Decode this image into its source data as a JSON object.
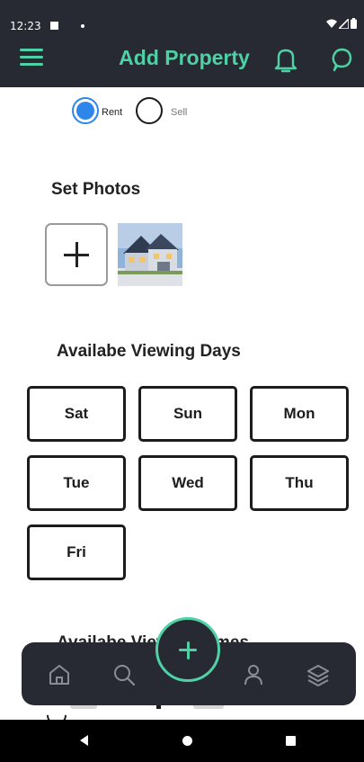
{
  "status_bar": {
    "time": "12:23"
  },
  "header": {
    "title": "Add Property",
    "icons": [
      "menu-icon",
      "bell-icon",
      "chat-icon"
    ],
    "background": "#282a33",
    "accent": "#4fd1a5"
  },
  "listing_type": {
    "options": [
      {
        "label": "Rent",
        "selected": true
      },
      {
        "label": "Sell",
        "selected": false
      }
    ],
    "selected_color": "#2e86ea"
  },
  "photos": {
    "title": "Set Photos",
    "add_icon": "plus-icon"
  },
  "viewing_days": {
    "title": "Availabe Viewing Days",
    "days": [
      "Sat",
      "Sun",
      "Mon",
      "Tue",
      "Wed",
      "Thu",
      "Fri"
    ]
  },
  "viewing_times": {
    "title": "Availabe Viewing Times"
  },
  "bottom_nav": {
    "items": [
      "home-icon",
      "search-icon",
      "add-icon",
      "profile-icon",
      "layers-icon"
    ]
  },
  "system_nav": {
    "items": [
      "back-icon",
      "home-icon",
      "recents-icon"
    ]
  }
}
